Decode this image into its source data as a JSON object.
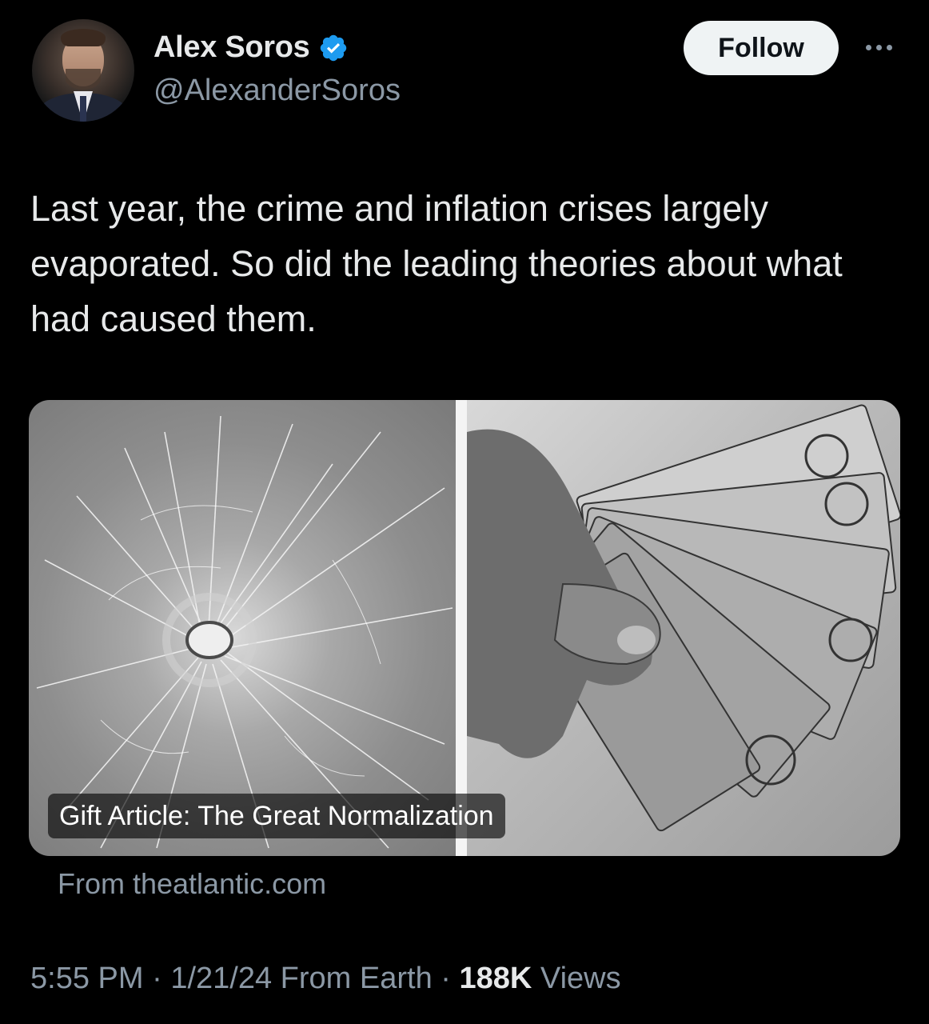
{
  "author": {
    "name": "Alex Soros",
    "handle": "@AlexanderSoros",
    "verified_icon": "verified-badge-icon",
    "verified_color": "#1d9bf0"
  },
  "actions": {
    "follow_label": "Follow",
    "more_icon": "more-dots-icon"
  },
  "tweet": {
    "text": "Last year, the crime and inflation crises largely evaporated. So did the leading theories about what had caused them."
  },
  "card": {
    "title": "Gift Article: The Great Normalization",
    "source": "From theatlantic.com",
    "left_image": "shattered-glass-bullet-hole",
    "right_image": "hand-holding-dollar-bills"
  },
  "meta": {
    "time": "5:55 PM",
    "date": "1/21/24",
    "location": "From Earth",
    "separator": "·",
    "views_count": "188K",
    "views_label": "Views"
  },
  "colors": {
    "background": "#000000",
    "text": "#e7e9ea",
    "secondary": "#8b98a5",
    "follow_bg": "#eff3f4"
  }
}
